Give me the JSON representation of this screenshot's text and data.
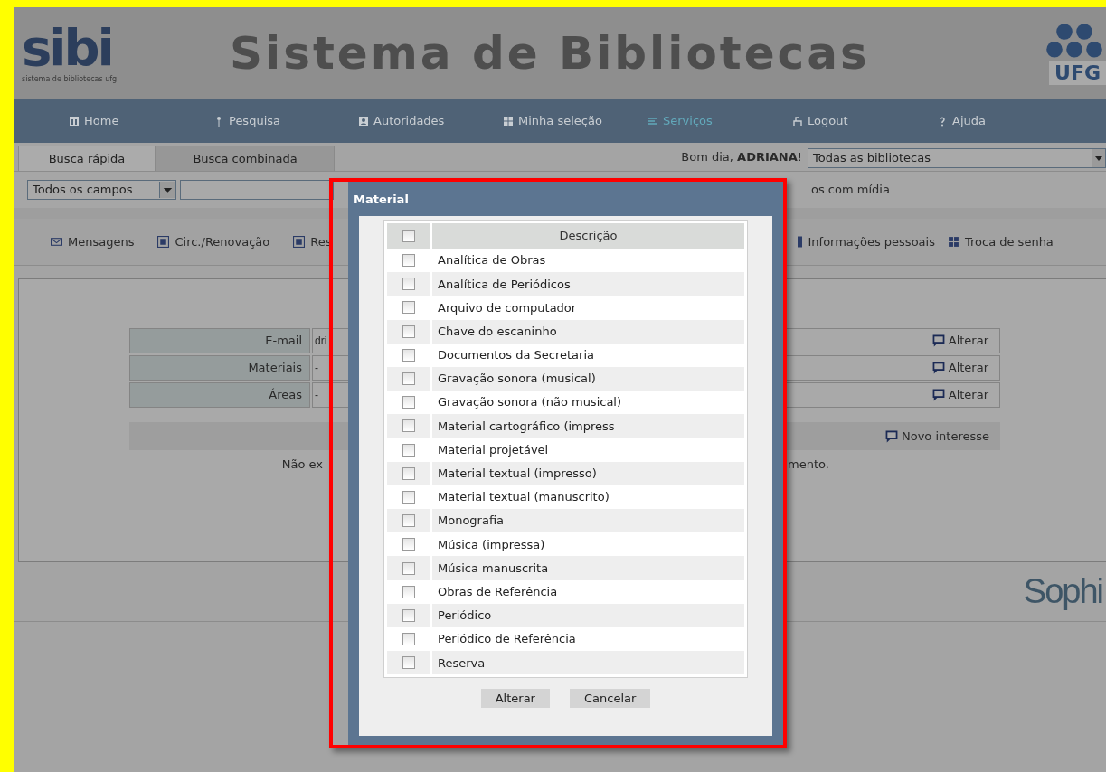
{
  "banner": {
    "logo": "sibi",
    "logo_caption": "sistema de bibliotecas ufg",
    "title": "Sistema de Bibliotecas",
    "badge": "UFG"
  },
  "nav": [
    {
      "label": "Home",
      "kind": "home",
      "selected": false
    },
    {
      "label": "Pesquisa",
      "kind": "pin",
      "selected": false
    },
    {
      "label": "Autoridades",
      "kind": "person",
      "selected": false
    },
    {
      "label": "Minha seleção",
      "kind": "grid",
      "selected": false
    },
    {
      "label": "Serviços",
      "kind": "list",
      "selected": true
    },
    {
      "label": "Logout",
      "kind": "exit",
      "selected": false
    },
    {
      "label": "Ajuda",
      "kind": "help",
      "selected": false
    }
  ],
  "search_tabs": [
    {
      "label": "Busca rápida",
      "selected": true
    },
    {
      "label": "Busca combinada",
      "selected": false
    }
  ],
  "greeting": "Bom dia, **ADRIANA**!",
  "library_select": "Todas as bibliotecas",
  "field_select": "Todos os campos",
  "media_option": "os com mídia",
  "menu": [
    {
      "label": "Mensagens",
      "kind": "mail"
    },
    {
      "label": "Circ./Renovação",
      "kind": "square"
    },
    {
      "label": "Res",
      "kind": "square"
    },
    {
      "label": "Informações pessoais",
      "kind": "half"
    },
    {
      "label": "Troca de senha",
      "kind": "grid"
    }
  ],
  "interests": [
    {
      "label": "E-mail",
      "value": "dri",
      "action": "Alterar"
    },
    {
      "label": "Materiais",
      "value": "-",
      "action": "Alterar"
    },
    {
      "label": "Áreas",
      "value": "-",
      "action": "Alterar"
    }
  ],
  "new_interest": "Novo interesse",
  "message_left": "Não ex",
  "message_right": "mento.",
  "footer_logo": "Sophi",
  "dialog": {
    "title": "Material",
    "header_checked": false,
    "column": "Descrição",
    "items": [
      {
        "label": "Analítica de Obras",
        "checked": false
      },
      {
        "label": "Analítica de Periódicos",
        "checked": false
      },
      {
        "label": "Arquivo de computador",
        "checked": false
      },
      {
        "label": "Chave do escaninho",
        "checked": false
      },
      {
        "label": "Documentos da Secretaria",
        "checked": false
      },
      {
        "label": "Gravação sonora (musical)",
        "checked": false
      },
      {
        "label": "Gravação sonora (não musical)",
        "checked": false
      },
      {
        "label": "Material cartográfico (impress",
        "checked": false
      },
      {
        "label": "Material projetável",
        "checked": false
      },
      {
        "label": "Material textual (impresso)",
        "checked": false
      },
      {
        "label": "Material textual (manuscrito)",
        "checked": false
      },
      {
        "label": "Monografia",
        "checked": false
      },
      {
        "label": "Música (impressa)",
        "checked": false
      },
      {
        "label": "Música manuscrita",
        "checked": false
      },
      {
        "label": "Obras de Referência",
        "checked": false
      },
      {
        "label": "Periódico",
        "checked": false
      },
      {
        "label": "Periódico de Referência",
        "checked": false
      },
      {
        "label": "Reserva",
        "checked": false
      }
    ],
    "buttons": [
      "Alterar",
      "Cancelar"
    ]
  }
}
